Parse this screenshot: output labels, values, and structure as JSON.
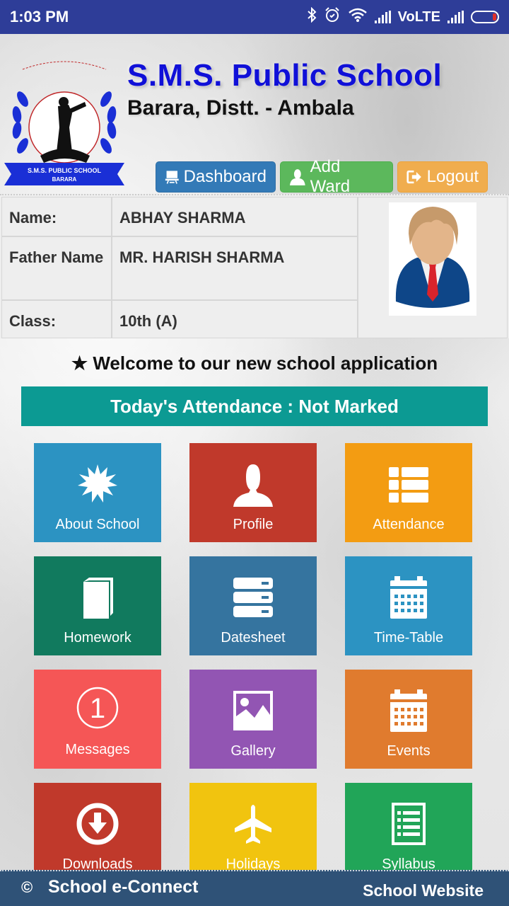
{
  "status_bar": {
    "time": "1:03 PM",
    "network_label": "VoLTE",
    "icons": [
      "bluetooth-icon",
      "alarm-icon",
      "wifi-icon",
      "signal-icon",
      "signal-icon",
      "battery-icon"
    ]
  },
  "header": {
    "school_name": "S.M.S. Public School",
    "school_address": "Barara, Distt. - Ambala",
    "logo": {
      "ribbon_line1": "S.M.S. PUBLIC SCHOOL",
      "ribbon_line2": "BARARA"
    },
    "buttons": [
      {
        "label": "Dashboard",
        "icon": "dashboard-icon",
        "color": "#337ab7"
      },
      {
        "label": "Add Ward",
        "icon": "user-icon",
        "color": "#5cb85c"
      },
      {
        "label": "Logout",
        "icon": "logout-icon",
        "color": "#f0ad4e"
      }
    ]
  },
  "student": {
    "rows": [
      {
        "label": "Name:",
        "value": "ABHAY SHARMA"
      },
      {
        "label": "Father Name",
        "value": "MR. HARISH SHARMA"
      },
      {
        "label": "Class:",
        "value": "10th (A)"
      }
    ]
  },
  "welcome": {
    "star": "★",
    "text": "Welcome to our new school application"
  },
  "attendance": {
    "text": "Today's Attendance : Not Marked",
    "color": "#0c9a93"
  },
  "tiles": [
    {
      "label": "About School",
      "icon": "badge-icon",
      "color": "#2c93c2"
    },
    {
      "label": "Profile",
      "icon": "user-icon",
      "color": "#c0392b"
    },
    {
      "label": "Attendance",
      "icon": "list-icon",
      "color": "#f39c12"
    },
    {
      "label": "Homework",
      "icon": "book-icon",
      "color": "#117a5e"
    },
    {
      "label": "Datesheet",
      "icon": "server-icon",
      "color": "#35749f"
    },
    {
      "label": "Time-Table",
      "icon": "calendar-icon",
      "color": "#2c93c2"
    },
    {
      "label": "Messages",
      "icon": "message-count-icon",
      "color": "#f55656",
      "badge": "1"
    },
    {
      "label": "Gallery",
      "icon": "image-icon",
      "color": "#9255b3"
    },
    {
      "label": "Events",
      "icon": "calendar-icon",
      "color": "#e07b2e"
    },
    {
      "label": "Downloads",
      "icon": "download-icon",
      "color": "#c0392b"
    },
    {
      "label": "Holidays",
      "icon": "plane-icon",
      "color": "#f1c40f"
    },
    {
      "label": "Syllabus",
      "icon": "list-document-icon",
      "color": "#21a558"
    }
  ],
  "footer": {
    "copyright_symbol": "©",
    "brand": "School e-Connect",
    "website_link": "School Website"
  }
}
